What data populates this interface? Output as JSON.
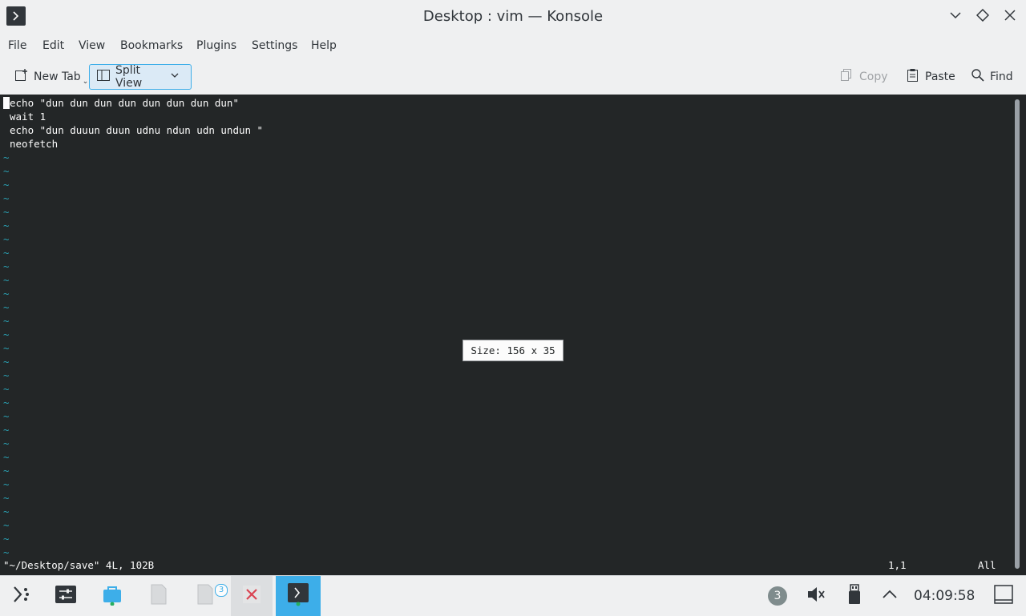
{
  "window": {
    "title": "Desktop : vim — Konsole"
  },
  "menu": {
    "items": [
      "File",
      "Edit",
      "View",
      "Bookmarks",
      "Plugins",
      "Settings",
      "Help"
    ]
  },
  "toolbar": {
    "new_tab_label": "New Tab",
    "split_view_label": "Split View",
    "copy_label": "Copy",
    "paste_label": "Paste",
    "find_label": "Find"
  },
  "terminal": {
    "lines": [
      "echo \"dun dun dun dun dun dun dun dun\"",
      "wait 1",
      "echo \"dun duuun duun udnu ndun udn undun \"",
      "neofetch"
    ],
    "tilde": "~",
    "status_left": "\"~/Desktop/save\" 4L, 102B",
    "status_position": "1,1",
    "status_scroll": "All",
    "size_tooltip": "Size: 156 x 35"
  },
  "taskbar": {
    "badge_count": "3",
    "notification_count": "3",
    "clock": "04:09:58"
  },
  "colors": {
    "accent": "#3daee9",
    "terminal_bg": "#232627",
    "tilde": "#2aa1b3"
  }
}
